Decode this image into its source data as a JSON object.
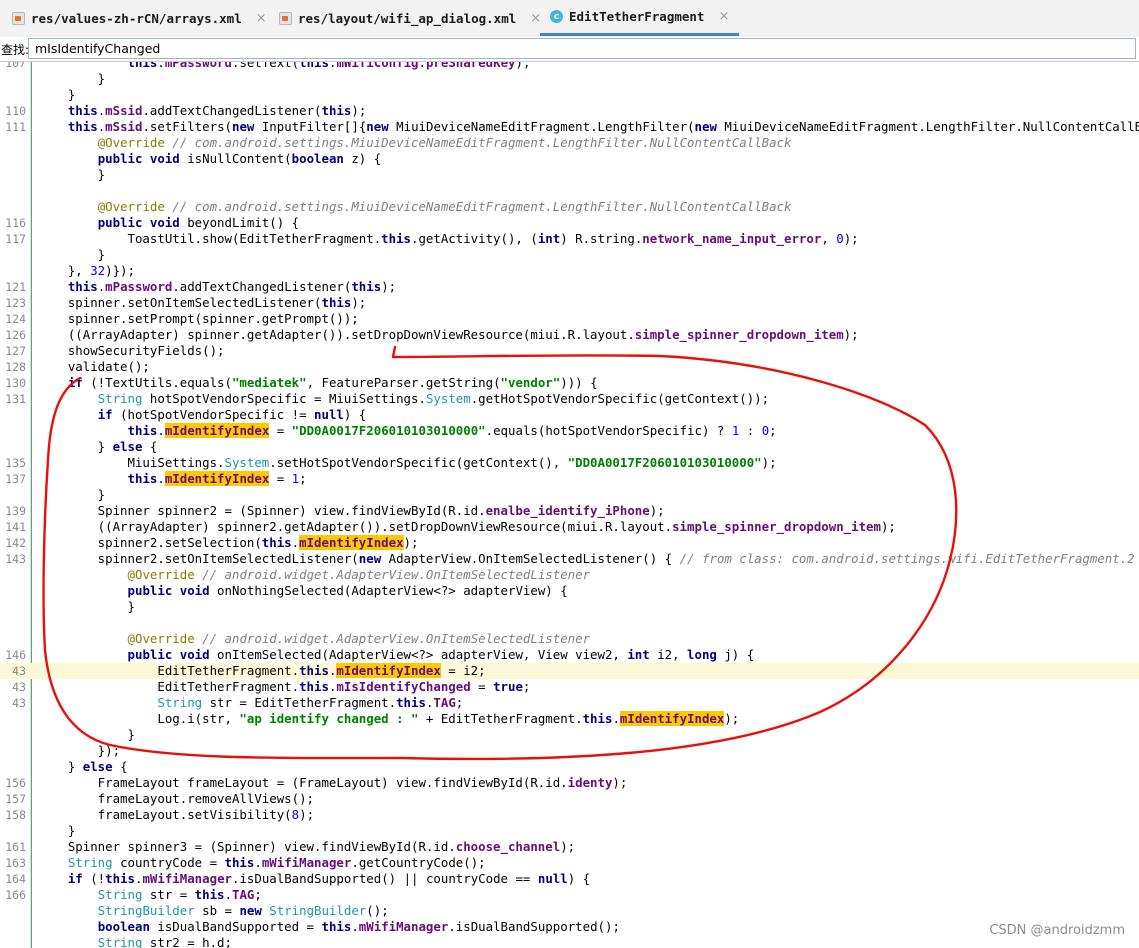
{
  "tabs": [
    {
      "label": "res/values-zh-rCN/arrays.xml",
      "icon": "xml-file-icon",
      "close": "×"
    },
    {
      "label": "res/layout/wifi_ap_dialog.xml",
      "icon": "xml-file-icon",
      "close": "×"
    },
    {
      "label": "EditTetherFragment",
      "icon": "java-class-icon",
      "icon_letter": "c",
      "close": "×",
      "active": true
    }
  ],
  "find": {
    "label": "查找:",
    "value": "mIsIdentifyChanged"
  },
  "watermark": "CSDN @androidzmm",
  "colors": {
    "keyword": "#000080",
    "field": "#660e7a",
    "string": "#008000",
    "comment": "#808080",
    "annotation": "#808000",
    "search_match": "#ffc800",
    "current_line": "#fcfad6",
    "red_annotation": "#e8110a"
  },
  "editor": {
    "current_line_index": 38,
    "lines": [
      {
        "ln": "107",
        "html": "            <span class=\"kw\">this</span>.<span class=\"fld\">mPassword</span>.setText(<span class=\"kw\">this</span>.<span class=\"fld\">mWifiConfig</span>.<span class=\"fld\">preSharedKey</span>);"
      },
      {
        "ln": "",
        "html": "        }"
      },
      {
        "ln": "",
        "html": "    }"
      },
      {
        "ln": "110",
        "html": "    <span class=\"kw\">this</span>.<span class=\"fld\">mSsid</span>.addTextChangedListener(<span class=\"kw\">this</span>);"
      },
      {
        "ln": "111",
        "html": "    <span class=\"kw\">this</span>.<span class=\"fld\">mSsid</span>.setFilters(<span class=\"kw\">new</span> InputFilter[]{<span class=\"kw\">new</span> MiuiDeviceNameEditFragment.LengthFilter(<span class=\"kw\">new</span> MiuiDeviceNameEditFragment.LengthFilter.NullContentCallBack() {"
      },
      {
        "ln": "",
        "html": "        <span class=\"ann\">@Override</span> <span class=\"cm\">// com.android.settings.MiuiDeviceNameEditFragment.LengthFilter.NullContentCallBack</span>"
      },
      {
        "ln": "",
        "html": "        <span class=\"kw\">public void</span> isNullContent(<span class=\"kw\">boolean</span> z) {"
      },
      {
        "ln": "",
        "html": "        }"
      },
      {
        "ln": "",
        "html": ""
      },
      {
        "ln": "",
        "html": "        <span class=\"ann\">@Override</span> <span class=\"cm\">// com.android.settings.MiuiDeviceNameEditFragment.LengthFilter.NullContentCallBack</span>"
      },
      {
        "ln": "116",
        "html": "        <span class=\"kw\">public void</span> beyondLimit() {"
      },
      {
        "ln": "117",
        "html": "            ToastUtil.show(EditTetherFragment.<span class=\"kw\">this</span>.getActivity(), (<span class=\"kw\">int</span>) R.string.<span class=\"fld\">network_name_input_error</span>, <span class=\"num\">0</span>);"
      },
      {
        "ln": "",
        "html": "        }"
      },
      {
        "ln": "",
        "html": "    }, <span class=\"num\">32</span>)});"
      },
      {
        "ln": "121",
        "html": "    <span class=\"kw\">this</span>.<span class=\"fld\">mPassword</span>.addTextChangedListener(<span class=\"kw\">this</span>);"
      },
      {
        "ln": "123",
        "html": "    spinner.setOnItemSelectedListener(<span class=\"kw\">this</span>);"
      },
      {
        "ln": "124",
        "html": "    spinner.setPrompt(spinner.getPrompt());"
      },
      {
        "ln": "126",
        "html": "    ((ArrayAdapter) spinner.getAdapter()).setDropDownViewResource(miui.R.layout.<span class=\"fld\">simple_spinner_dropdown_item</span>);"
      },
      {
        "ln": "127",
        "html": "    showSecurityFields();"
      },
      {
        "ln": "128",
        "html": "    validate();"
      },
      {
        "ln": "130",
        "html": "    <span class=\"kw\">if</span> (!TextUtils.equals(<span class=\"str\">\"mediatek\"</span>, FeatureParser.getString(<span class=\"str\">\"vendor\"</span>))) {"
      },
      {
        "ln": "131",
        "html": "        <span class=\"tp\">String</span> hotSpotVendorSpecific = MiuiSettings.<span class=\"tp\">System</span>.getHotSpotVendorSpecific(getContext());"
      },
      {
        "ln": "",
        "html": "        <span class=\"kw\">if</span> (hotSpotVendorSpecific != <span class=\"kw\">null</span>) {"
      },
      {
        "ln": "",
        "html": "            <span class=\"kw\">this</span>.<span class=\"fld mark\">mIdentifyIndex</span> = <span class=\"str\">\"DD0A0017F206010103010000\"</span>.equals(hotSpotVendorSpecific) ? <span class=\"num\">1</span> : <span class=\"num\">0</span>;"
      },
      {
        "ln": "",
        "html": "        } <span class=\"kw\">else</span> {"
      },
      {
        "ln": "135",
        "html": "            MiuiSettings.<span class=\"tp\">System</span>.setHotSpotVendorSpecific(getContext(), <span class=\"str\">\"DD0A0017F206010103010000\"</span>);"
      },
      {
        "ln": "137",
        "html": "            <span class=\"kw\">this</span>.<span class=\"fld mark\">mIdentifyIndex</span> = <span class=\"num\">1</span>;"
      },
      {
        "ln": "",
        "html": "        }"
      },
      {
        "ln": "139",
        "html": "        Spinner spinner2 = (Spinner) view.findViewById(R.id.<span class=\"fld\">enalbe_identify_iPhone</span>);"
      },
      {
        "ln": "141",
        "html": "        ((ArrayAdapter) spinner2.getAdapter()).setDropDownViewResource(miui.R.layout.<span class=\"fld\">simple_spinner_dropdown_item</span>);"
      },
      {
        "ln": "142",
        "html": "        spinner2.setSelection(<span class=\"kw\">this</span>.<span class=\"fld mark\">mIdentifyIndex</span>);"
      },
      {
        "ln": "143",
        "html": "        spinner2.setOnItemSelectedListener(<span class=\"kw\">new</span> AdapterView.OnItemSelectedListener() { <span class=\"cm\">// from class: com.android.settings.wifi.EditTetherFragment.2</span>"
      },
      {
        "ln": "",
        "html": "            <span class=\"ann\">@Override</span> <span class=\"cm\">// android.widget.AdapterView.OnItemSelectedListener</span>"
      },
      {
        "ln": "",
        "html": "            <span class=\"kw\">public void</span> onNothingSelected(AdapterView&lt;?&gt; adapterView) {"
      },
      {
        "ln": "",
        "html": "            }"
      },
      {
        "ln": "",
        "html": ""
      },
      {
        "ln": "",
        "html": "            <span class=\"ann\">@Override</span> <span class=\"cm\">// android.widget.AdapterView.OnItemSelectedListener</span>"
      },
      {
        "ln": "146",
        "html": "            <span class=\"kw\">public void</span> onItemSelected(AdapterView&lt;?&gt; adapterView, View view2, <span class=\"kw\">int</span> i2, <span class=\"kw\">long</span> j) {"
      },
      {
        "ln": "43",
        "html": "                EditTetherFragment.<span class=\"kw\">this</span>.<span class=\"fld mark\">mIdentifyIndex</span> = i2;"
      },
      {
        "ln": "43",
        "html": "                EditTetherFragment.<span class=\"kw\">this</span>.<span class=\"fld\">mIsIdentifyChanged</span> = <span class=\"kw\">true</span>;"
      },
      {
        "ln": "43",
        "html": "                <span class=\"tp\">String</span> str = EditTetherFragment.<span class=\"kw\">this</span>.<span class=\"fld\">TAG</span>;"
      },
      {
        "ln": "",
        "html": "                Log.i(str, <span class=\"str\">\"ap identify changed : \"</span> + EditTetherFragment.<span class=\"kw\">this</span>.<span class=\"fld mark\">mIdentifyIndex</span>);"
      },
      {
        "ln": "",
        "html": "            }"
      },
      {
        "ln": "",
        "html": "        });"
      },
      {
        "ln": "",
        "html": "    } <span class=\"kw\">else</span> {"
      },
      {
        "ln": "156",
        "html": "        FrameLayout frameLayout = (FrameLayout) view.findViewById(R.id.<span class=\"fld\">identy</span>);"
      },
      {
        "ln": "157",
        "html": "        frameLayout.removeAllViews();"
      },
      {
        "ln": "158",
        "html": "        frameLayout.setVisibility(<span class=\"num\">8</span>);"
      },
      {
        "ln": "",
        "html": "    }"
      },
      {
        "ln": "161",
        "html": "    Spinner spinner3 = (Spinner) view.findViewById(R.id.<span class=\"fld\">choose_channel</span>);"
      },
      {
        "ln": "163",
        "html": "    <span class=\"tp\">String</span> countryCode = <span class=\"kw\">this</span>.<span class=\"fld\">mWifiManager</span>.getCountryCode();"
      },
      {
        "ln": "164",
        "html": "    <span class=\"kw\">if</span> (!<span class=\"kw\">this</span>.<span class=\"fld\">mWifiManager</span>.isDualBandSupported() || countryCode == <span class=\"kw\">null</span>) {"
      },
      {
        "ln": "166",
        "html": "        <span class=\"tp\">String</span> str = <span class=\"kw\">this</span>.<span class=\"fld\">TAG</span>;"
      },
      {
        "ln": "",
        "html": "        <span class=\"tp\">StringBuilder</span> sb = <span class=\"kw\">new</span> <span class=\"tp\">StringBuilder</span>();"
      },
      {
        "ln": "",
        "html": "        <span class=\"kw\">boolean</span> isDualBandSupported = <span class=\"kw\">this</span>.<span class=\"fld\">mWifiManager</span>.isDualBandSupported();"
      },
      {
        "ln": "",
        "html": "        <span class=\"tp\">String</span> str2 = h.d;"
      }
    ]
  }
}
